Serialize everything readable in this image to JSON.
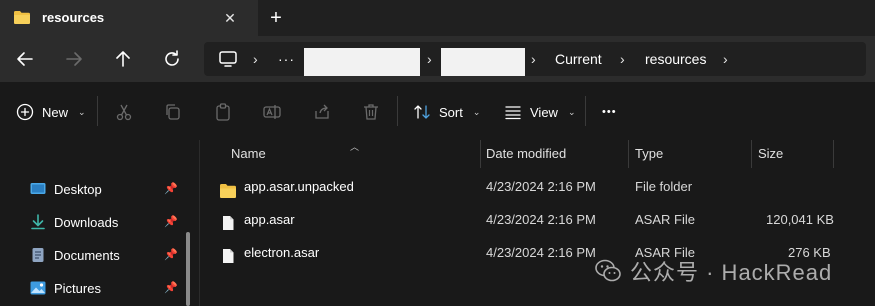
{
  "tab": {
    "title": "resources",
    "close_glyph": "✕",
    "new_glyph": "+"
  },
  "address": {
    "more_glyph": "···",
    "crumbs": [
      "Current",
      "resources"
    ],
    "sep": "›"
  },
  "toolbar": {
    "new_label": "New",
    "sort_label": "Sort",
    "view_label": "View",
    "more_glyph": "•••"
  },
  "sidebar": {
    "items": [
      {
        "label": "Desktop",
        "icon": "desktop-icon"
      },
      {
        "label": "Downloads",
        "icon": "download-icon"
      },
      {
        "label": "Documents",
        "icon": "document-icon"
      },
      {
        "label": "Pictures",
        "icon": "pictures-icon"
      }
    ],
    "pin_glyph": "📌"
  },
  "columns": {
    "name": "Name",
    "date": "Date modified",
    "type": "Type",
    "size": "Size"
  },
  "files": [
    {
      "name": "app.asar.unpacked",
      "date": "4/23/2024 2:16 PM",
      "type": "File folder",
      "size": "",
      "icon": "folder-icon"
    },
    {
      "name": "app.asar",
      "date": "4/23/2024 2:16 PM",
      "type": "ASAR File",
      "size": "120,041 KB",
      "icon": "file-icon"
    },
    {
      "name": "electron.asar",
      "date": "4/23/2024 2:16 PM",
      "type": "ASAR File",
      "size": "276 KB",
      "icon": "file-icon"
    }
  ],
  "watermark": {
    "text": "公众号 · HackRead"
  },
  "colors": {
    "folder": "#f0c043",
    "accent": "#4fa3e0"
  }
}
